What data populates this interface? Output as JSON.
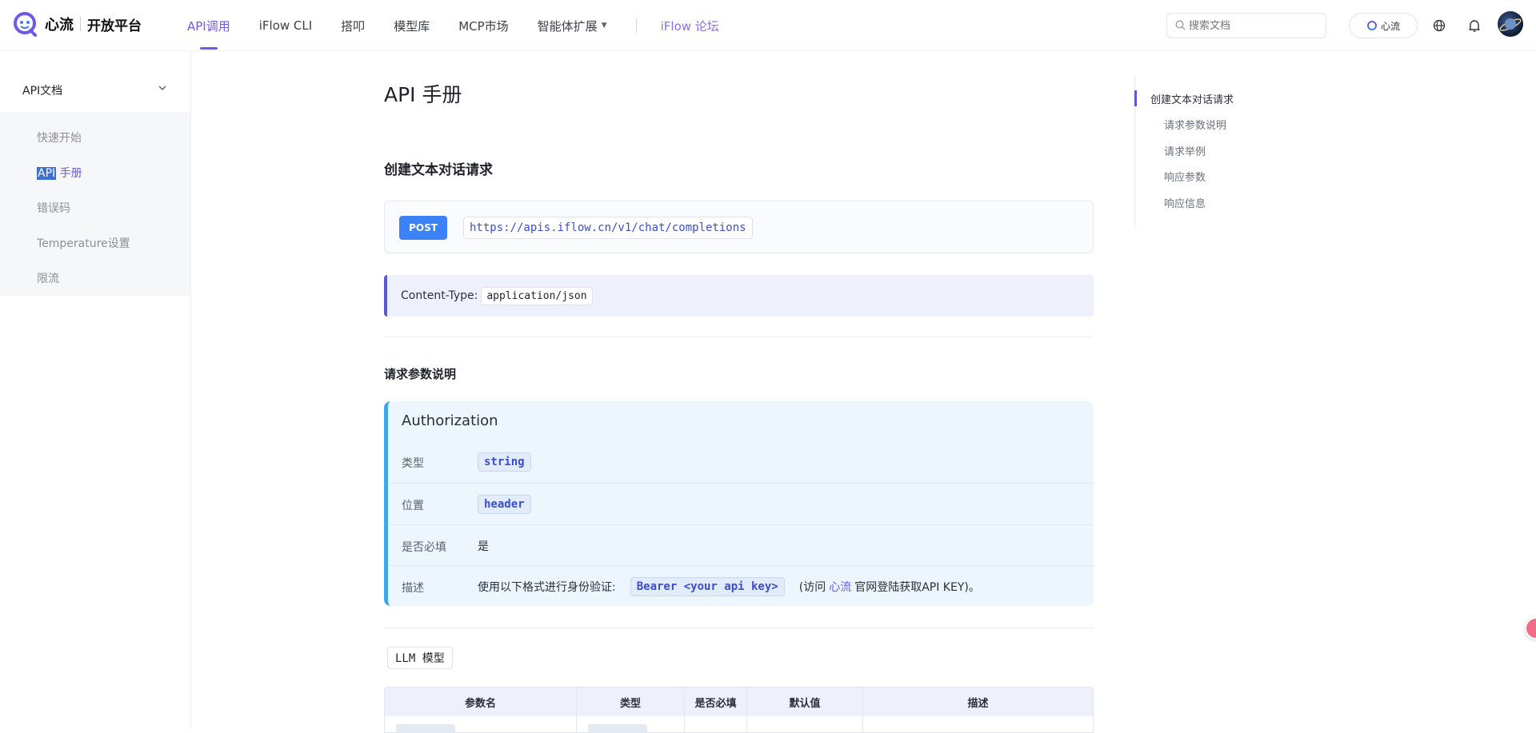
{
  "header": {
    "brand": "心流",
    "platform": "开放平台",
    "nav": [
      {
        "label": "API调用",
        "active": true
      },
      {
        "label": "iFlow CLI"
      },
      {
        "label": "搭叩"
      },
      {
        "label": "模型库"
      },
      {
        "label": "MCP市场"
      },
      {
        "label": "智能体扩展",
        "dropdown": true
      }
    ],
    "forum": "iFlow 论坛",
    "search_placeholder": "搜索文档",
    "brand_button": "心流"
  },
  "sidebar": {
    "heading": "API文档",
    "items": [
      {
        "label": "快速开始"
      },
      {
        "label_highlight": "API",
        "label_rest": " 手册",
        "active": true
      },
      {
        "label": "错误码"
      },
      {
        "label": "Temperature设置"
      },
      {
        "label": "限流"
      }
    ]
  },
  "main": {
    "title": "API 手册",
    "section1": "创建文本对话请求",
    "method": "POST",
    "url": "https://apis.iflow.cn/v1/chat/completions",
    "content_type_label": "Content-Type:",
    "content_type_value": "application/json",
    "section2": "请求参数说明",
    "auth": {
      "title": "Authorization",
      "rows": [
        {
          "label": "类型",
          "value": "string"
        },
        {
          "label": "位置",
          "value": "header"
        },
        {
          "label": "是否必填",
          "value": "是"
        },
        {
          "label": "描述",
          "prefix": "使用以下格式进行身份验证:",
          "code": "Bearer <your api key>",
          "mid": "(访问",
          "link": "心流",
          "suffix": "官网登陆获取API KEY)。"
        }
      ]
    },
    "llm_tag": "LLM 模型",
    "table_headers": [
      "参数名",
      "类型",
      "是否必填",
      "默认值",
      "描述"
    ]
  },
  "toc": {
    "items": [
      "创建文本对话请求",
      "请求参数说明",
      "请求举例",
      "响应参数",
      "响应信息"
    ]
  },
  "colors": {
    "accent": "#6f59e8",
    "post": "#3b82f6",
    "auth_border": "#3ea6ef"
  }
}
